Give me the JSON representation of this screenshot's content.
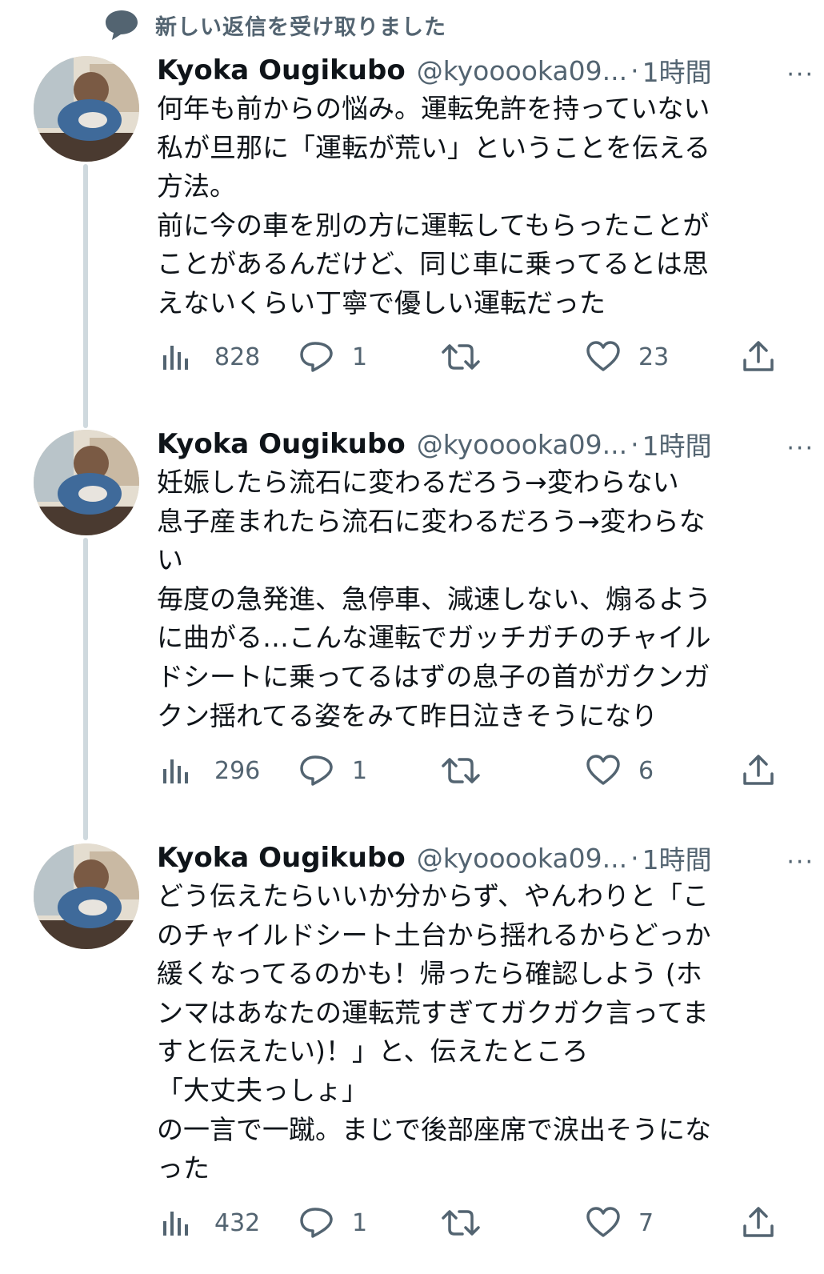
{
  "notice": {
    "text": "新しい返信を受け取りました",
    "icon": "speech-bubble-icon"
  },
  "colors": {
    "text": "#0f1419",
    "secondary": "#536471",
    "thread": "#cfd9de"
  },
  "tweets": [
    {
      "name": "Kyoka Ougikubo",
      "handle": "@kyooooka09...",
      "separator": "·",
      "time": "1時間",
      "more": "···",
      "lines": [
        "何年も前からの悩み。運転免許を持っていない",
        "私が旦那に「運転が荒い」ということを伝える",
        "方法。",
        "前に今の車を別の方に運転してもらったことが",
        "ことがあるんだけど、同じ車に乗ってるとは思",
        "えないくらい丁寧で優しい運転だった"
      ],
      "views": "828",
      "replies": "1",
      "likes": "23"
    },
    {
      "name": "Kyoka Ougikubo",
      "handle": "@kyooooka09...",
      "separator": "·",
      "time": "1時間",
      "more": "···",
      "lines": [
        "妊娠したら流石に変わるだろう→変わらない",
        "息子産まれたら流石に変わるだろう→変わらな",
        "い",
        "毎度の急発進、急停車、減速しない、煽るよう",
        "に曲がる…こんな運転でガッチガチのチャイル",
        "ドシートに乗ってるはずの息子の首がガクンガ",
        "クン揺れてる姿をみて昨日泣きそうになり"
      ],
      "views": "296",
      "replies": "1",
      "likes": "6"
    },
    {
      "name": "Kyoka Ougikubo",
      "handle": "@kyooooka09...",
      "separator": "·",
      "time": "1時間",
      "more": "···",
      "lines": [
        "どう伝えたらいいか分からず、やんわりと「こ",
        "のチャイルドシート土台から揺れるからどっか",
        "緩くなってるのかも！帰ったら確認しよう (ホ",
        "ンマはあなたの運転荒すぎてガクガク言ってま",
        "すと伝えたい)！」と、伝えたところ",
        "「大丈夫っしょ」",
        "の一言で一蹴。まじで後部座席で涙出そうにな",
        "った"
      ],
      "views": "432",
      "replies": "1",
      "likes": "7"
    }
  ]
}
